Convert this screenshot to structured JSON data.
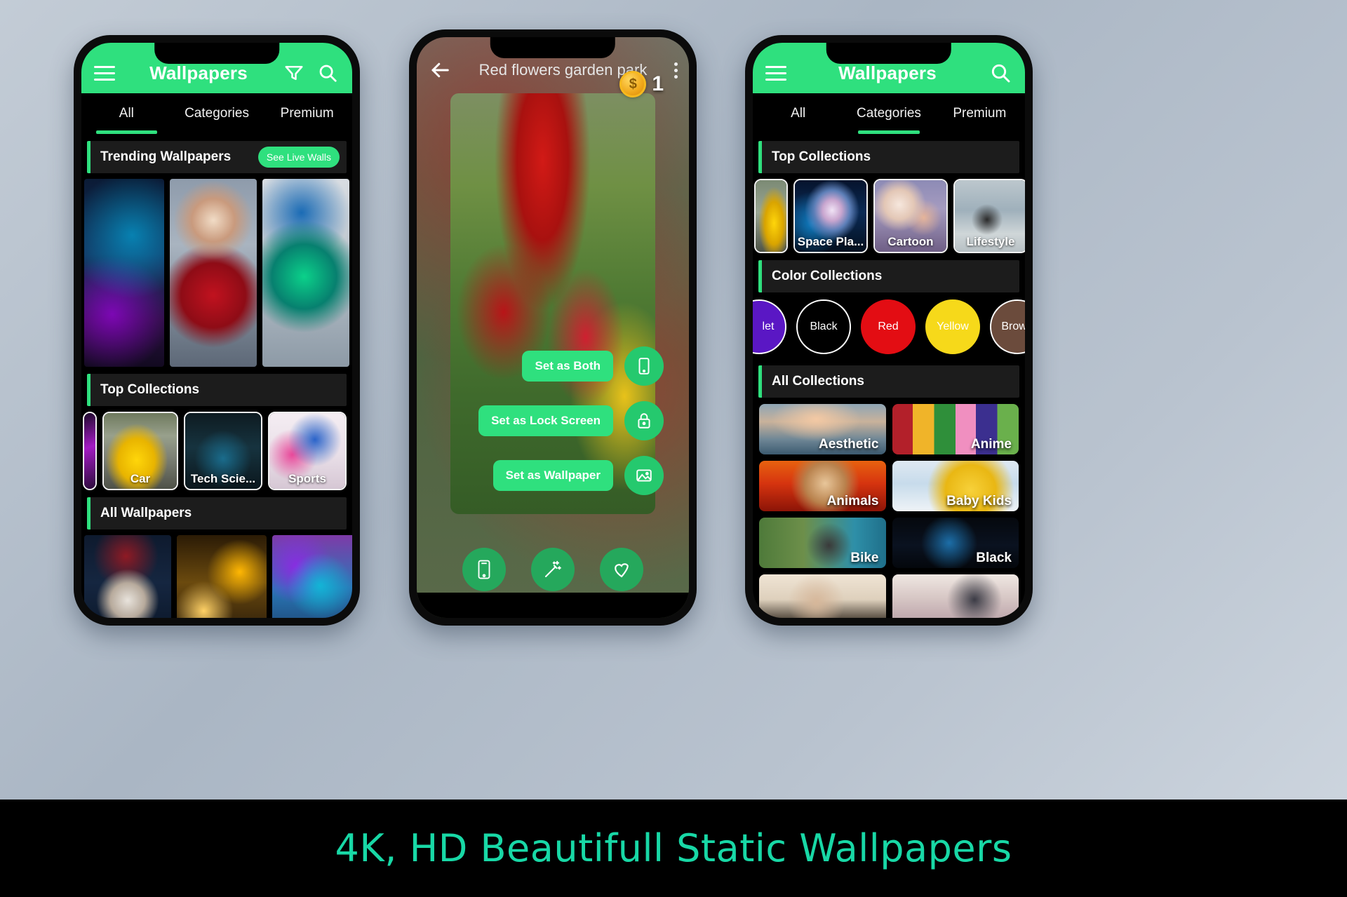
{
  "banner": {
    "text": "4K, HD Beautifull Static Wallpapers",
    "color": "#18d8a6"
  },
  "theme": {
    "accent": "#2fe07e",
    "surface": "#1c1c1c",
    "background": "#000000"
  },
  "phone1": {
    "appbar": {
      "title": "Wallpapers",
      "menu_icon": "hamburger-icon",
      "filter_icon": "filter-funnel-icon",
      "search_icon": "search-icon"
    },
    "tabs": [
      {
        "label": "All",
        "active": true
      },
      {
        "label": "Categories",
        "active": false
      },
      {
        "label": "Premium",
        "active": false
      }
    ],
    "sections": [
      {
        "title": "Trending Wallpapers",
        "action_label": "See Live Walls"
      },
      {
        "title": "Top Collections"
      },
      {
        "title": "All Wallpapers"
      }
    ],
    "trending": [
      {
        "caption": ""
      },
      {
        "caption": ""
      },
      {
        "caption": ""
      },
      {
        "caption": ""
      }
    ],
    "top_collections": [
      {
        "label": ""
      },
      {
        "label": "Car"
      },
      {
        "label": "Tech Scie..."
      },
      {
        "label": "Sports"
      },
      {
        "label": ""
      }
    ],
    "all_wallpapers": [
      {
        "caption": ""
      },
      {
        "caption": ""
      },
      {
        "caption": ""
      }
    ]
  },
  "phone2": {
    "back_icon": "back-arrow-icon",
    "title": "Red flowers garden park",
    "overflow_icon": "more-vertical-icon",
    "coin": {
      "icon": "coin-icon",
      "symbol": "$",
      "count": "1"
    },
    "actions": [
      {
        "label": "Set as Both",
        "icon": "phone-icon"
      },
      {
        "label": "Set as Lock Screen",
        "icon": "lock-icon"
      },
      {
        "label": "Set as Wallpaper",
        "icon": "image-icon"
      }
    ],
    "bottom_icons": [
      {
        "name": "preview-phone-icon"
      },
      {
        "name": "magic-wand-icon"
      },
      {
        "name": "heart-favorite-icon"
      }
    ]
  },
  "phone3": {
    "appbar": {
      "title": "Wallpapers",
      "menu_icon": "hamburger-icon",
      "search_icon": "search-icon"
    },
    "tabs": [
      {
        "label": "All",
        "active": false
      },
      {
        "label": "Categories",
        "active": true
      },
      {
        "label": "Premium",
        "active": false
      }
    ],
    "sections": [
      {
        "title": "Top Collections"
      },
      {
        "title": "Color Collections"
      },
      {
        "title": "All Collections"
      }
    ],
    "top_collections": [
      {
        "label": ""
      },
      {
        "label": "Space Pla..."
      },
      {
        "label": "Cartoon"
      },
      {
        "label": "Lifestyle"
      }
    ],
    "colors": [
      {
        "label": "let",
        "hex": "#5a17c4",
        "text": "#ffffff"
      },
      {
        "label": "Black",
        "hex": "#000000",
        "text": "#ffffff"
      },
      {
        "label": "Red",
        "hex": "#e30d13",
        "text": "#ffffff"
      },
      {
        "label": "Yellow",
        "hex": "#f6d91a",
        "text": "#ffffff"
      },
      {
        "label": "Brown",
        "hex": "#6b4b3c",
        "text": "#ffffff"
      }
    ],
    "all_collections": [
      {
        "label": "Aesthetic"
      },
      {
        "label": "Anime"
      },
      {
        "label": "Animals"
      },
      {
        "label": "Baby Kids"
      },
      {
        "label": "Bike"
      },
      {
        "label": "Black"
      },
      {
        "label": ""
      },
      {
        "label": ""
      }
    ]
  }
}
